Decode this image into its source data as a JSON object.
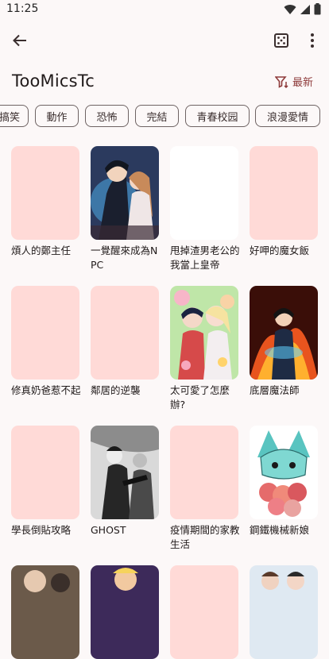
{
  "status": {
    "time": "11:25"
  },
  "header": {
    "source_name": "TooMicsTc",
    "sort_label": "最新"
  },
  "genres": [
    "搞笑",
    "動作",
    "恐怖",
    "完結",
    "青春校园",
    "浪漫愛情"
  ],
  "comics": [
    {
      "title": "煩人的鄭主任",
      "cover": "blank-pink"
    },
    {
      "title": "一覺醒來成為NPC",
      "cover": "art-dark-romance"
    },
    {
      "title": "甩掉渣男老公的我當上皇帝",
      "cover": "blank-white"
    },
    {
      "title": "好呷的魔女飯",
      "cover": "blank-pink"
    },
    {
      "title": "修真奶爸惹不起",
      "cover": "blank-pink"
    },
    {
      "title": "鄰居的逆襲",
      "cover": "blank-pink"
    },
    {
      "title": "太可愛了怎麼辦?",
      "cover": "art-flower-couple"
    },
    {
      "title": "底層魔法師",
      "cover": "art-fire-mage"
    },
    {
      "title": "學長倒貼攻略",
      "cover": "blank-pink"
    },
    {
      "title": "GHOST",
      "cover": "art-bw-fight"
    },
    {
      "title": "疫情期間的家教生活",
      "cover": "blank-pink"
    },
    {
      "title": "鋼鐵機械新娘",
      "cover": "art-mecha-bouquet"
    },
    {
      "title": "",
      "cover": "art-partial-1"
    },
    {
      "title": "",
      "cover": "art-partial-2"
    },
    {
      "title": "",
      "cover": "blank-pink"
    },
    {
      "title": "",
      "cover": "art-partial-3"
    }
  ]
}
